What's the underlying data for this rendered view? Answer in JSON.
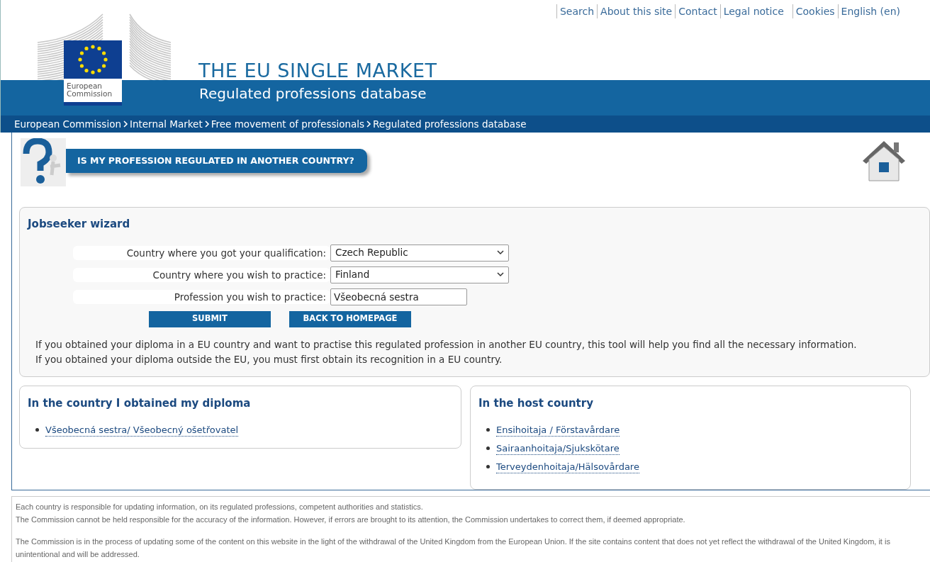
{
  "top_links": [
    "Search",
    "About this site",
    "Contact",
    "Legal notice",
    "Cookies",
    "English (en)"
  ],
  "header": {
    "logo_text": "European Commission",
    "title": "THE EU SINGLE MARKET",
    "subtitle": "Regulated professions database"
  },
  "breadcrumb": [
    "European Commission",
    "Internal Market",
    "Free movement of professionals",
    "Regulated professions database"
  ],
  "banner": {
    "title": "IS MY PROFESSION REGULATED IN ANOTHER COUNTRY?"
  },
  "wizard": {
    "title": "Jobseeker wizard",
    "fields": [
      {
        "kind": "select",
        "label": "Country where you got your qualification:",
        "value": "Czech Republic"
      },
      {
        "kind": "select",
        "label": "Country where you wish to practice:",
        "value": "Finland"
      },
      {
        "kind": "text",
        "label": "Profession you wish to practice:",
        "value": "Všeobecná sestra"
      }
    ],
    "buttons": [
      "SUBMIT",
      "BACK TO HOMEPAGE"
    ],
    "info": [
      "If you obtained your diploma in a EU country and want to practise this regulated profession in another EU country, this tool will help you find all the necessary information.",
      "If you obtained your diploma outside the EU, you must first obtain its recognition in a EU country."
    ]
  },
  "panels": [
    {
      "title": "In the country I obtained my diploma",
      "links": [
        "Všeobecná sestra/ Všeobecný ošetřovatel"
      ]
    },
    {
      "title": "In the host country",
      "links": [
        "Ensihoitaja / Förstavårdare",
        "Sairaanhoitaja/Sjukskötare",
        "Terveydenhoitaja/Hälsovårdare"
      ]
    }
  ],
  "footer": [
    [
      "Each country is responsible for updating information, on its regulated professions, competent authorities and statistics.",
      "The Commission cannot be held responsible for the accuracy of the information. However, if errors are brought to its attention, the Commission undertakes to correct them, if deemed appropriate."
    ],
    [
      "The Commission is in the process of updating some of the content on this website in the light of the withdrawal of the United Kingdom from the European Union. If the site contains content that does not yet reflect the withdrawal of the United Kingdom, it is unintentional and will be addressed."
    ]
  ]
}
